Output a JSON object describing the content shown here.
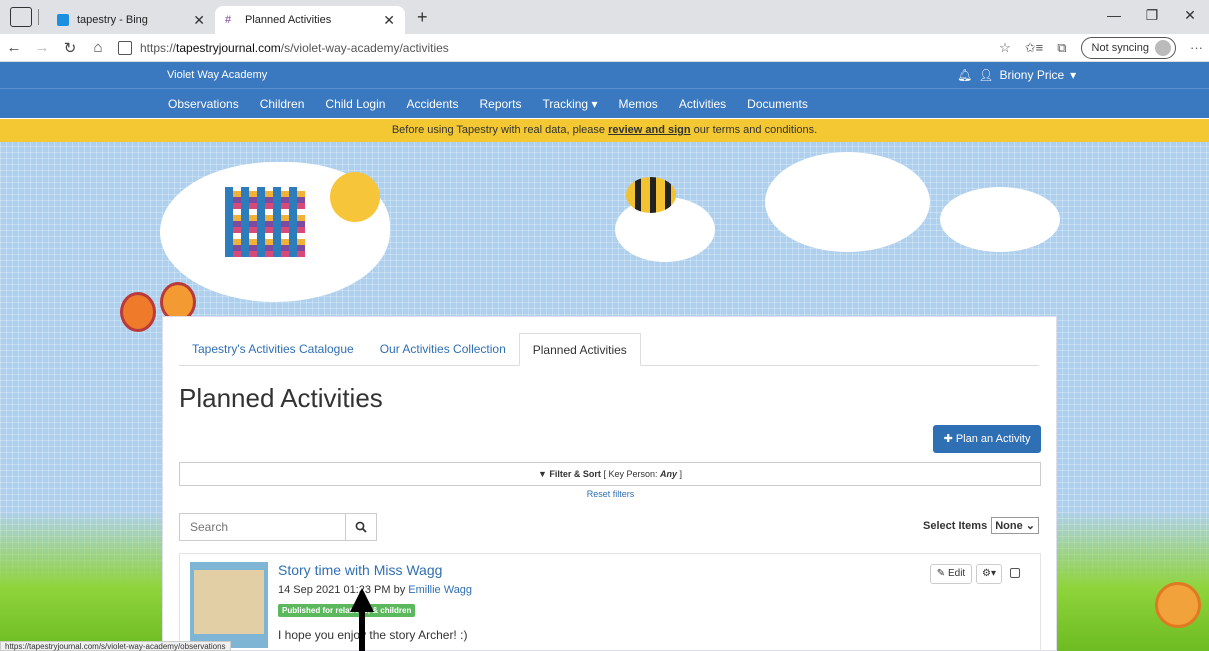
{
  "browser": {
    "tabs": [
      {
        "title": "tapestry - Bing",
        "active": false
      },
      {
        "title": "Planned Activities",
        "active": true
      }
    ],
    "url_prefix": "https://",
    "url_domain": "tapestryjournal.com",
    "url_path": "/s/violet-way-academy/activities",
    "sync_label": "Not syncing",
    "status_url": "https://tapestryjournal.com/s/violet-way-academy/observations"
  },
  "app": {
    "brand": "Violet Way Academy",
    "user": "Briony Price",
    "menu": [
      "Observations",
      "Children",
      "Child Login",
      "Accidents",
      "Reports",
      "Tracking",
      "Memos",
      "Activities",
      "Documents"
    ],
    "notice_before": "Before using Tapestry with real data, please ",
    "notice_link": "review and sign",
    "notice_after": " our terms and conditions."
  },
  "page": {
    "tabs": [
      "Tapestry's Activities Catalogue",
      "Our Activities Collection",
      "Planned Activities"
    ],
    "title": "Planned Activities",
    "plan_button": "Plan an Activity",
    "filter_label": "Filter & Sort",
    "filter_detail_prefix": "[ Key Person: ",
    "filter_detail_value": "Any",
    "filter_detail_suffix": " ]",
    "reset_filters": "Reset filters",
    "search_placeholder": "Search",
    "select_items_label": "Select Items",
    "select_items_value": "None"
  },
  "activity": {
    "title": "Story time with Miss Wagg",
    "date_text": "14 Sep 2021 01:23 PM by ",
    "author": "Emillie Wagg",
    "badge": "Published for relatives, & children",
    "body": "I hope you enjoy the story Archer! :)",
    "edit_label": "Edit"
  },
  "colors": {
    "navbar": "#3a78bf",
    "notice": "#f3c832",
    "accent": "#2f6fb4",
    "badge": "#5cb85c"
  }
}
